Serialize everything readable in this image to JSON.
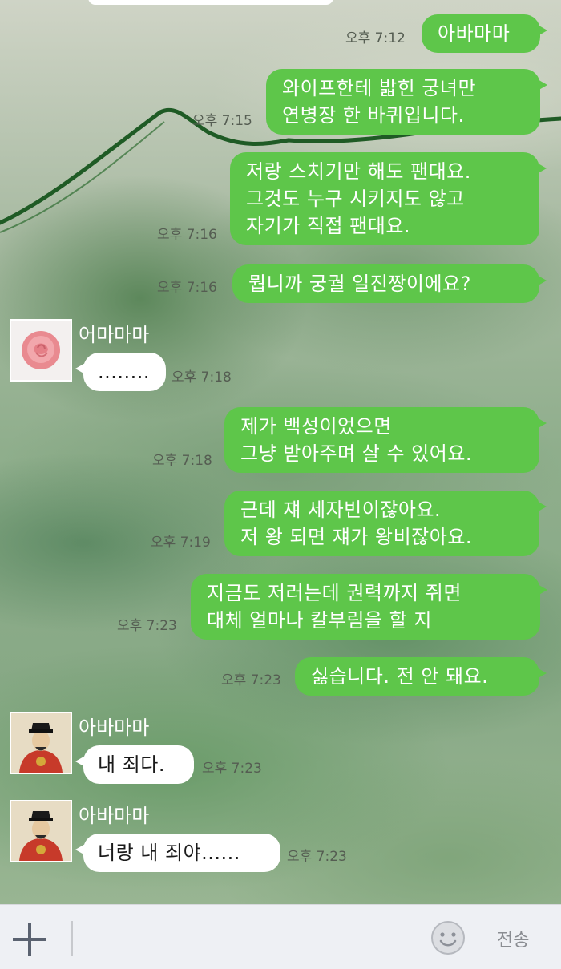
{
  "app": {
    "accent": "#5ec64a"
  },
  "messages": [
    {
      "who": "me",
      "text": "아바마마",
      "time": "오후 7:12"
    },
    {
      "who": "me",
      "text": "와이프한테 밟힌 궁녀만\n연병장 한 바퀴입니다.",
      "time": "오후 7:15"
    },
    {
      "who": "me",
      "text": "저랑 스치기만 해도 팬대요.\n그것도 누구 시키지도 않고\n자기가 직접 팬대요.",
      "time": "오후 7:16"
    },
    {
      "who": "me",
      "text": "뭡니까 궁궐 일진짱이에요?",
      "time": "오후 7:16"
    },
    {
      "who": "them",
      "sender": "어마마마",
      "avatar": "rose-avatar",
      "text": "........",
      "time": "오후 7:18"
    },
    {
      "who": "me",
      "text": "제가 백성이었으면\n그냥 받아주며 살 수 있어요.",
      "time": "오후 7:18"
    },
    {
      "who": "me",
      "text": "근데 쟤 세자빈이잖아요.\n저 왕 되면 쟤가 왕비잖아요.",
      "time": "오후 7:19"
    },
    {
      "who": "me",
      "text": "지금도 저러는데 권력까지 쥐면\n대체 얼마나 칼부림을 할 지",
      "time": "오후 7:23"
    },
    {
      "who": "me",
      "text": "싫습니다. 전 안 돼요.",
      "time": "오후 7:23"
    },
    {
      "who": "them",
      "sender": "아바마마",
      "avatar": "king-avatar",
      "text": "내 죄다.",
      "time": "오후 7:23"
    },
    {
      "who": "them",
      "sender": "아바마마",
      "avatar": "king-avatar",
      "text": "너랑 내 죄야......",
      "time": "오후 7:23"
    }
  ],
  "input_bar": {
    "placeholder": "",
    "add_icon": "plus-icon",
    "emoji_icon": "smiley-icon",
    "send_label": "전송"
  }
}
